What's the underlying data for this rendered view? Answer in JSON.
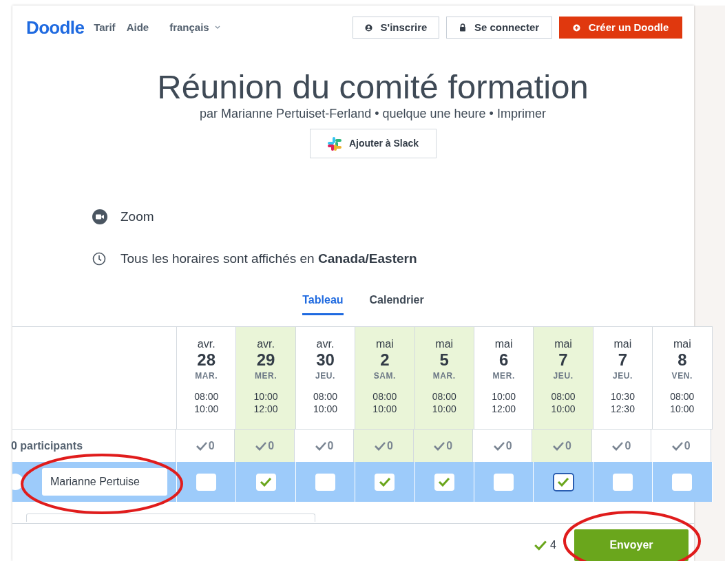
{
  "header": {
    "logo": "Doodle",
    "nav": [
      "Tarif",
      "Aide"
    ],
    "language": "français",
    "buttons": [
      {
        "kind": "signup",
        "label": "S'inscrire"
      },
      {
        "kind": "login",
        "label": "Se connecter"
      },
      {
        "kind": "create",
        "label": "Créer un Doodle"
      }
    ]
  },
  "poll": {
    "title": "Réunion du comité formation",
    "byline": "par Marianne Pertuiset-Ferland • quelque une heure • Imprimer",
    "slack_button": "Ajouter à Slack",
    "location": "Zoom",
    "timezone": "Tous les horaires sont affichés en **Canada/Eastern**"
  },
  "tabs": [
    {
      "label": "Tableau",
      "selected": true
    },
    {
      "label": "Calendrier",
      "selected": false
    }
  ],
  "table": {
    "participants_label": "0 participants",
    "participant_name": "Marianne Pertuise",
    "options": [
      {
        "month": "avr.",
        "day": "28",
        "weekday": "MAR.",
        "start": "08:00",
        "end": "10:00",
        "count": "0",
        "checked": false,
        "focused": false
      },
      {
        "month": "avr.",
        "day": "29",
        "weekday": "MER.",
        "start": "10:00",
        "end": "12:00",
        "count": "0",
        "checked": true,
        "focused": false
      },
      {
        "month": "avr.",
        "day": "30",
        "weekday": "JEU.",
        "start": "08:00",
        "end": "10:00",
        "count": "0",
        "checked": false,
        "focused": false
      },
      {
        "month": "mai",
        "day": "2",
        "weekday": "SAM.",
        "start": "08:00",
        "end": "10:00",
        "count": "0",
        "checked": true,
        "focused": false
      },
      {
        "month": "mai",
        "day": "5",
        "weekday": "MAR.",
        "start": "08:00",
        "end": "10:00",
        "count": "0",
        "checked": true,
        "focused": false
      },
      {
        "month": "mai",
        "day": "6",
        "weekday": "MER.",
        "start": "10:00",
        "end": "12:00",
        "count": "0",
        "checked": false,
        "focused": false
      },
      {
        "month": "mai",
        "day": "7",
        "weekday": "JEU.",
        "start": "08:00",
        "end": "10:00",
        "count": "0",
        "checked": true,
        "focused": true
      },
      {
        "month": "mai",
        "day": "7",
        "weekday": "JEU.",
        "start": "10:30",
        "end": "12:30",
        "count": "0",
        "checked": false,
        "focused": false
      },
      {
        "month": "mai",
        "day": "8",
        "weekday": "VEN.",
        "start": "08:00",
        "end": "10:00",
        "count": "0",
        "checked": false,
        "focused": false
      }
    ]
  },
  "footer": {
    "selected_count": "4",
    "submit_button": "Envoyer"
  }
}
